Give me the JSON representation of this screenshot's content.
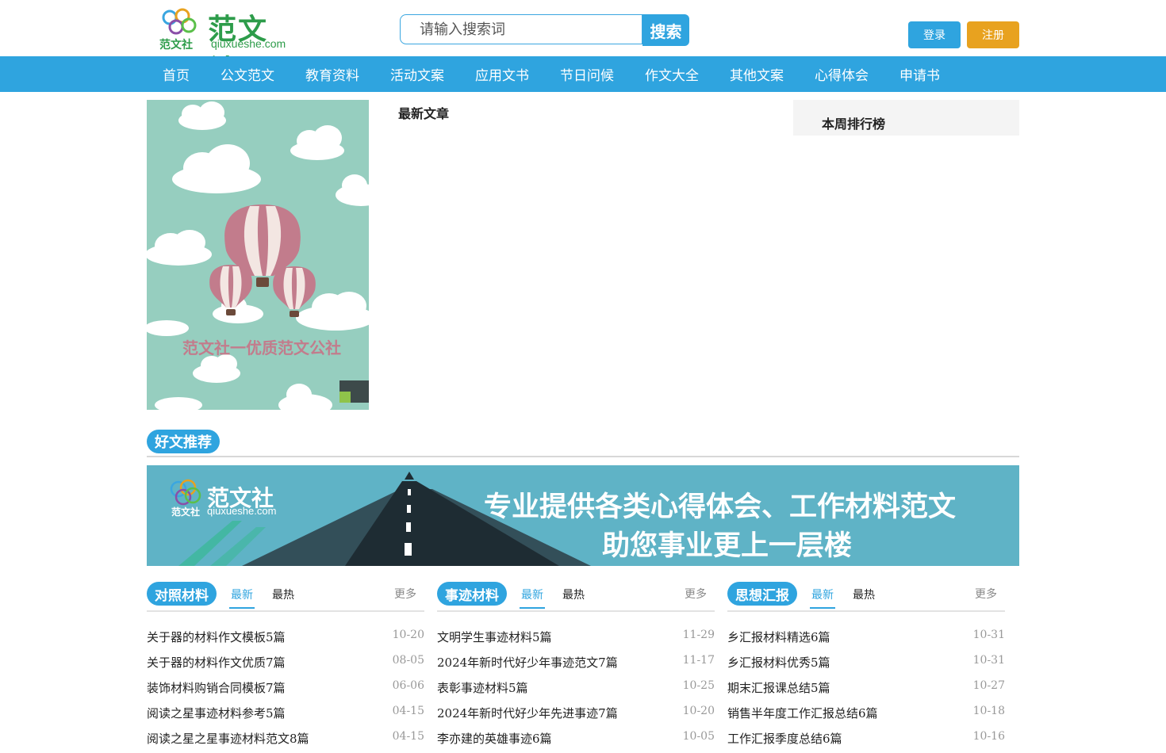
{
  "header": {
    "logo_cn": "范文社",
    "logo_small_cn": "范文社",
    "logo_domain": "qiuxueshe.com",
    "search_placeholder": "请输入搜索词",
    "search_button": "搜索",
    "login": "登录",
    "register": "注册"
  },
  "nav": [
    "首页",
    "公文范文",
    "教育资料",
    "活动文案",
    "应用文书",
    "节日问候",
    "作文大全",
    "其他文案",
    "心得体会",
    "申请书"
  ],
  "poster": {
    "caption": "范文社一优质范文公社"
  },
  "latest": {
    "title": "最新文章"
  },
  "ranking": {
    "title": "本周排行榜"
  },
  "recommend": {
    "badge": "好文推荐",
    "banner_logo_cn": "范文社",
    "banner_logo_small": "范文社",
    "banner_logo_domain": "qiuxueshe.com",
    "banner_line1": "专业提供各类心得体会、工作材料范文",
    "banner_line2": "助您事业更上一层楼"
  },
  "columns": [
    {
      "badge": "对照材料",
      "tab_new": "最新",
      "tab_hot": "最热",
      "more": "更多",
      "items": [
        {
          "title": "关于器的材料作文模板5篇",
          "date": "10-20"
        },
        {
          "title": "关于器的材料作文优质7篇",
          "date": "08-05"
        },
        {
          "title": "装饰材料购销合同模板7篇",
          "date": "06-06"
        },
        {
          "title": "阅读之星事迹材料参考5篇",
          "date": "04-15"
        },
        {
          "title": "阅读之星之星事迹材料范文8篇",
          "date": "04-15"
        }
      ]
    },
    {
      "badge": "事迹材料",
      "tab_new": "最新",
      "tab_hot": "最热",
      "more": "更多",
      "items": [
        {
          "title": "文明学生事迹材料5篇",
          "date": "11-29"
        },
        {
          "title": "2024年新时代好少年事迹范文7篇",
          "date": "11-17"
        },
        {
          "title": "表彰事迹材料5篇",
          "date": "10-25"
        },
        {
          "title": "2024年新时代好少年先进事迹7篇",
          "date": "10-20"
        },
        {
          "title": "李亦建的英雄事迹6篇",
          "date": "10-05"
        }
      ]
    },
    {
      "badge": "思想汇报",
      "tab_new": "最新",
      "tab_hot": "最热",
      "more": "更多",
      "items": [
        {
          "title": "乡汇报材料精选6篇",
          "date": "10-31"
        },
        {
          "title": "乡汇报材料优秀5篇",
          "date": "10-31"
        },
        {
          "title": "期末汇报课总结5篇",
          "date": "10-27"
        },
        {
          "title": "销售半年度工作汇报总结6篇",
          "date": "10-18"
        },
        {
          "title": "工作汇报季度总结6篇",
          "date": "10-16"
        }
      ]
    }
  ],
  "colors": {
    "primary": "#2fa4df",
    "register": "#e8a21f",
    "poster_bg": "#96cebf",
    "banner_bg": "#5fb3c6",
    "logo_green": "#2d9c4a"
  }
}
